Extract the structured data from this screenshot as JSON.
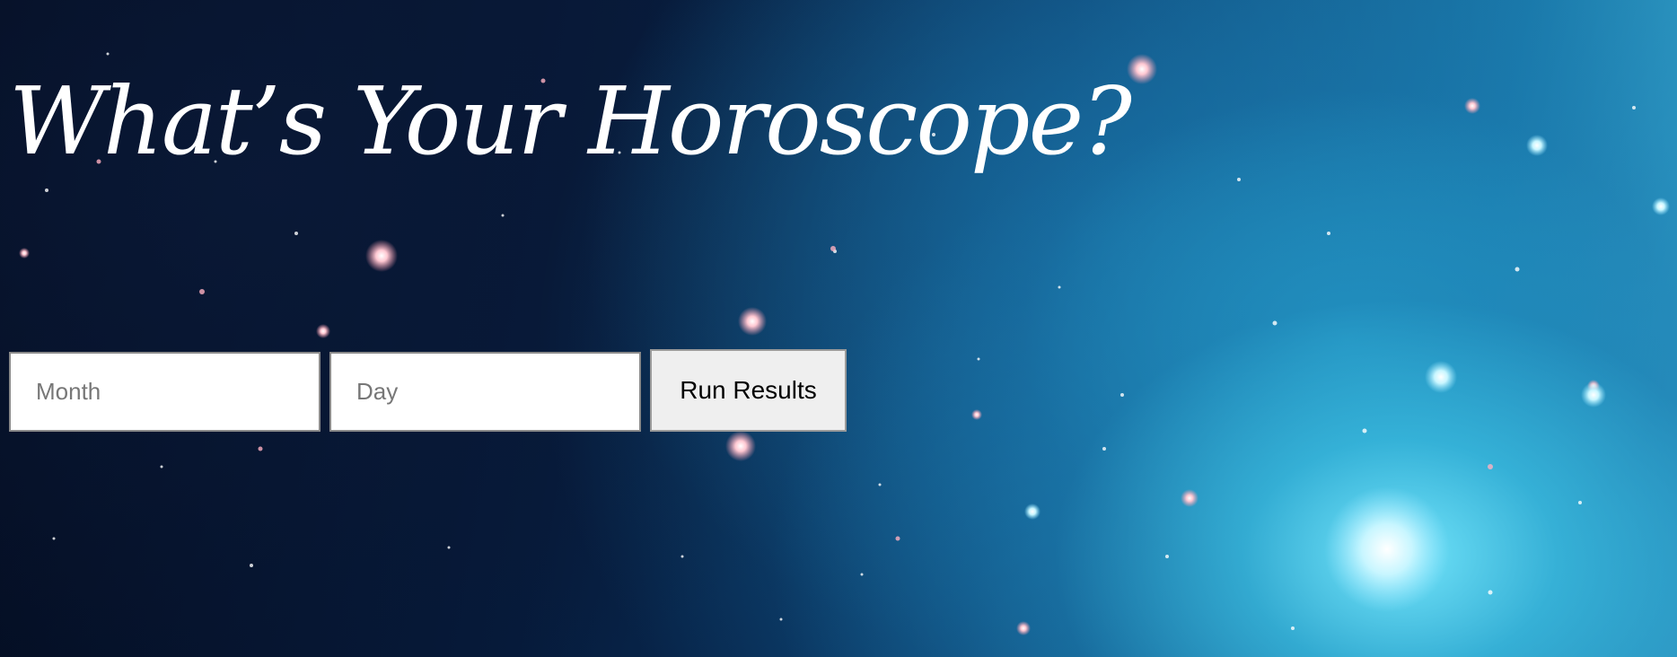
{
  "page": {
    "title": "What’s Your Horoscope?"
  },
  "form": {
    "month_placeholder": "Month",
    "day_placeholder": "Day",
    "submit_label": "Run Results"
  },
  "background": {
    "description_icon": "starfield-galaxy-image",
    "colors": {
      "deep_space": "#06152e",
      "nebula": "#3fb3d6",
      "glow": "#78ebff"
    }
  }
}
